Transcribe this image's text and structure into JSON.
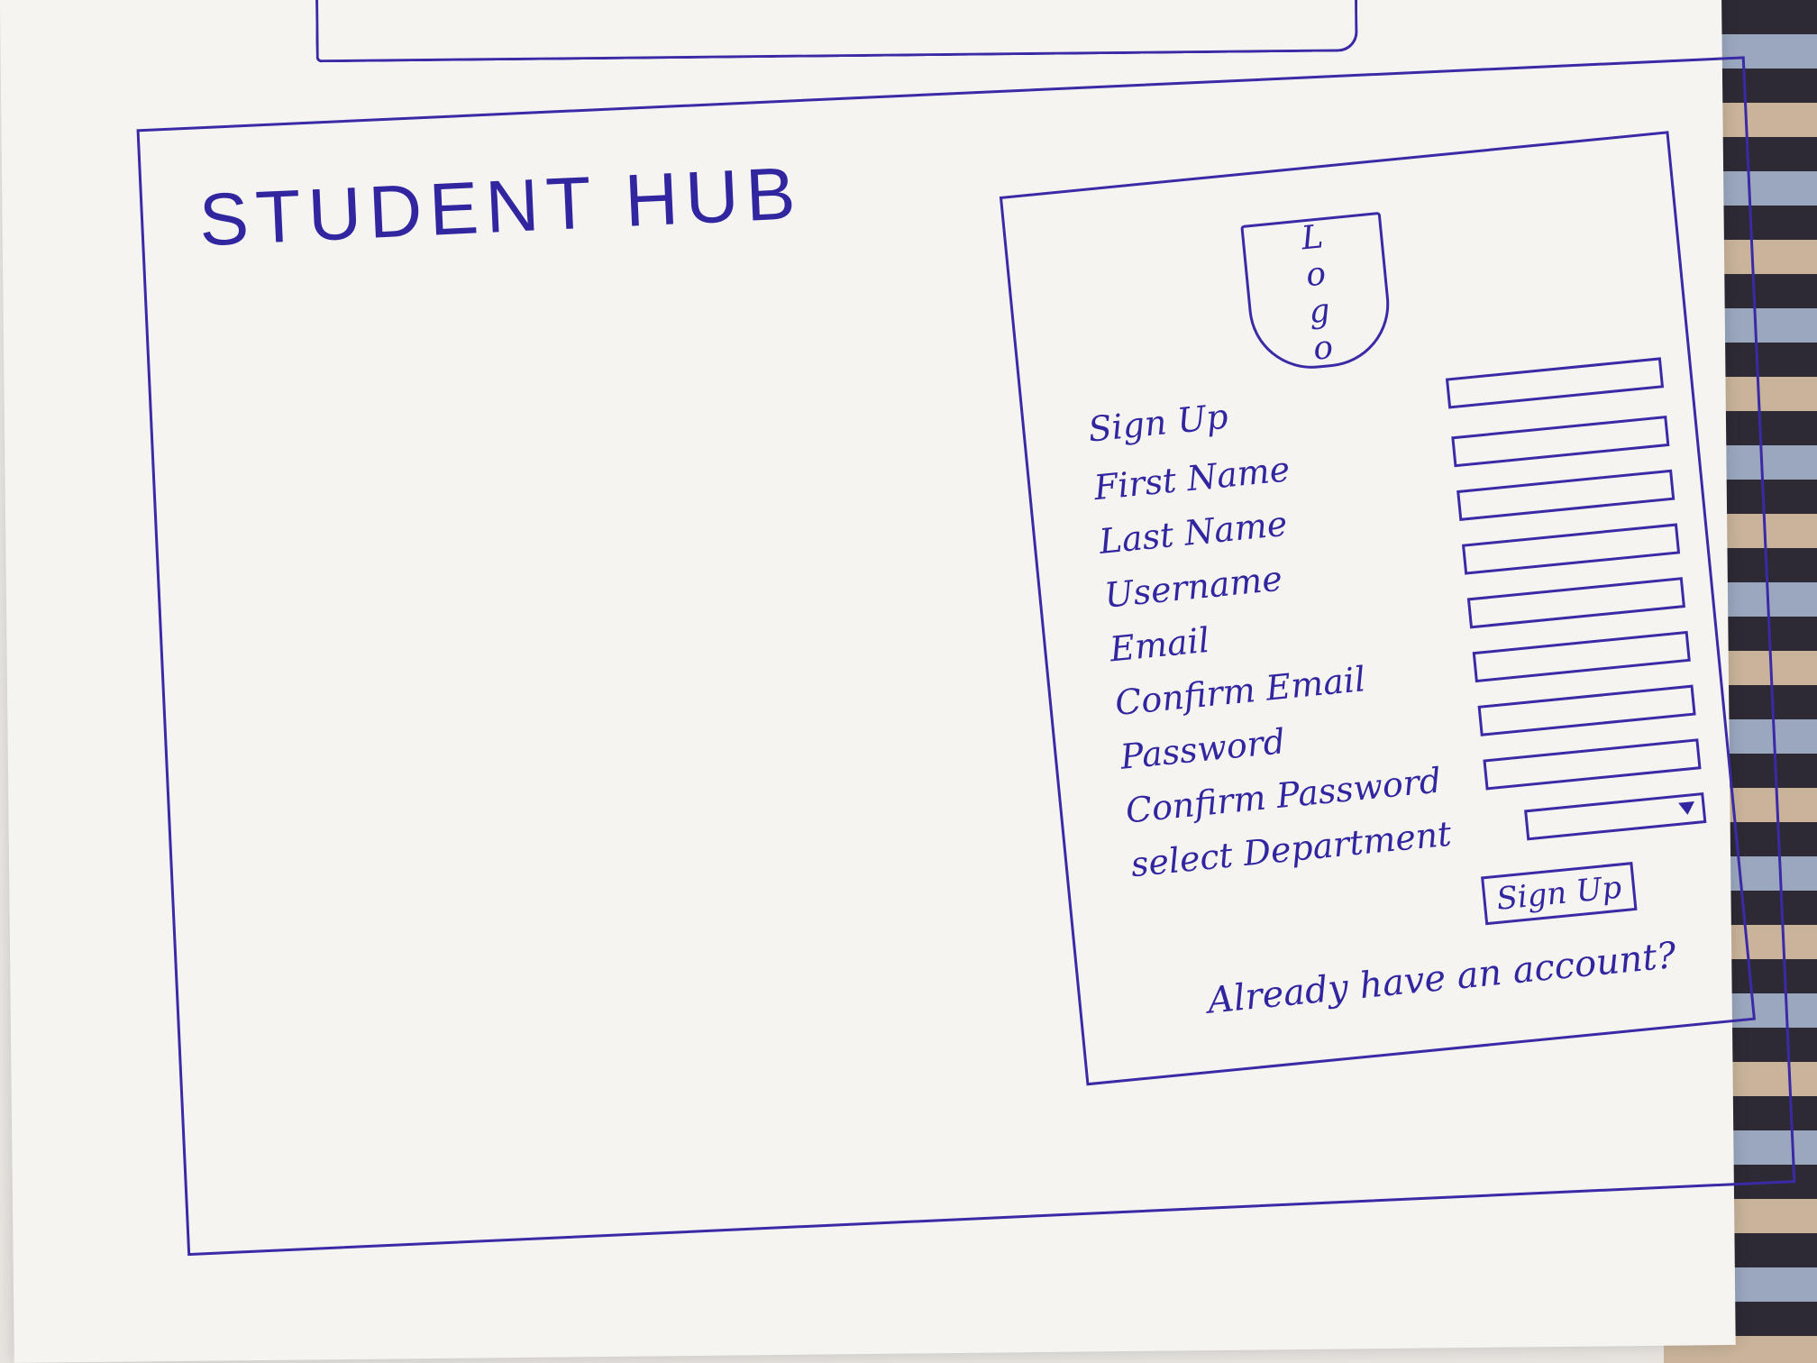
{
  "app": {
    "title": "STUDENT HUB"
  },
  "signup_card": {
    "logo_text": "Logo",
    "fields": [
      {
        "label": "Sign Up",
        "type": "text"
      },
      {
        "label": "First Name",
        "type": "text"
      },
      {
        "label": "Last Name",
        "type": "text"
      },
      {
        "label": "Username",
        "type": "text"
      },
      {
        "label": "Email",
        "type": "text"
      },
      {
        "label": "Confirm Email",
        "type": "text"
      },
      {
        "label": "Password",
        "type": "text"
      },
      {
        "label": "Confirm Password",
        "type": "text"
      },
      {
        "label": "select Department",
        "type": "select"
      }
    ],
    "submit_label": "Sign Up",
    "login_prompt": "Already have an account?"
  },
  "colors": {
    "ink": "#3126a0",
    "paper": "#f5f4f1"
  }
}
